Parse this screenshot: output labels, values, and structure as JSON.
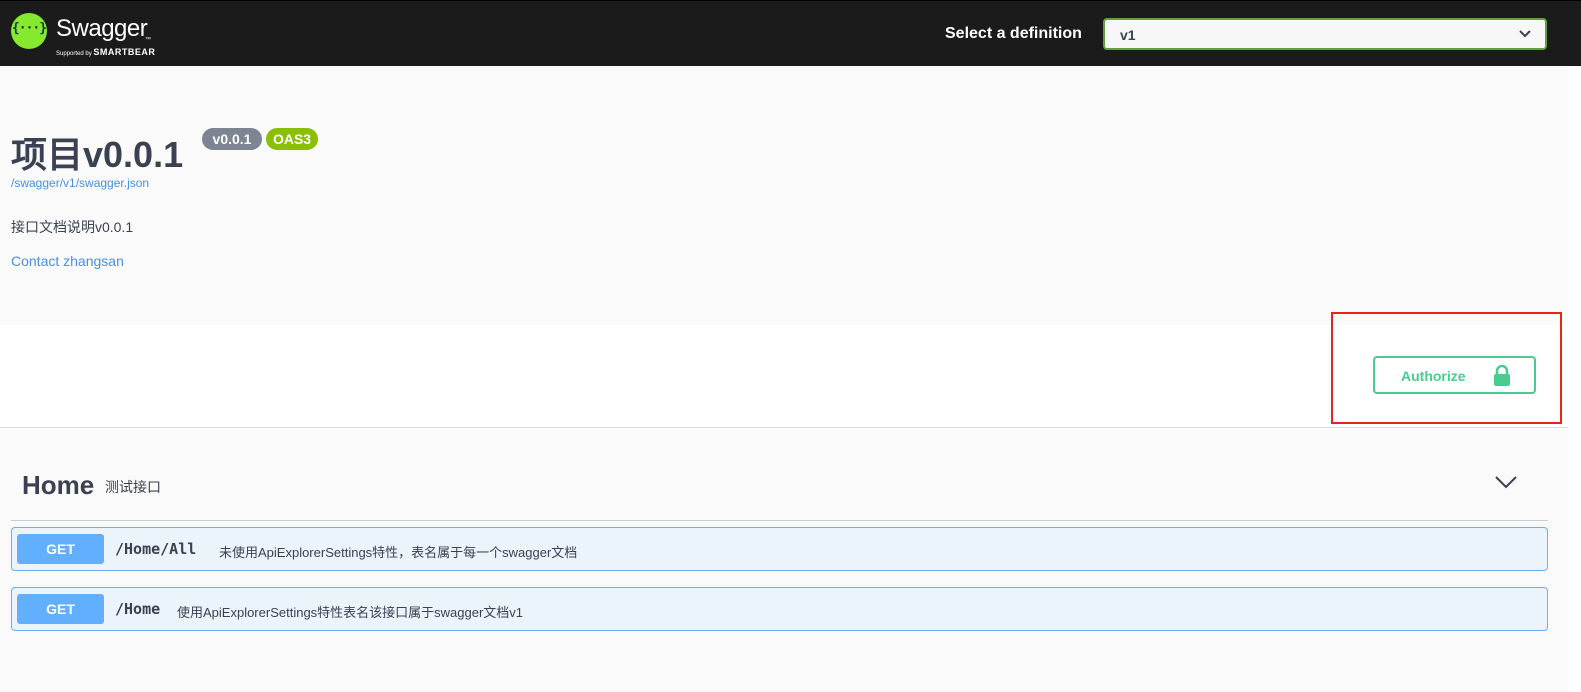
{
  "topbar": {
    "logo_title": "Swagger",
    "logo_tm": "™",
    "logo_supported": "Supported by",
    "logo_brand": "SMARTBEAR",
    "definition_label": "Select a definition",
    "definition_value": "v1"
  },
  "info": {
    "title": "项目v0.0.1",
    "version_badge": "v0.0.1",
    "oas_badge": "OAS3",
    "url": "/swagger/v1/swagger.json",
    "description": "接口文档说明v0.0.1",
    "contact": "Contact zhangsan"
  },
  "authorize": {
    "label": "Authorize",
    "color": "#49cc90",
    "highlight_color": "#e8231b"
  },
  "tags": [
    {
      "name": "Home",
      "description": "测试接口",
      "operations": [
        {
          "method": "GET",
          "path": "/Home/All",
          "summary": "未使用ApiExplorerSettings特性，表名属于每一个swagger文档"
        },
        {
          "method": "GET",
          "path": "/Home",
          "summary": "使用ApiExplorerSettings特性表名该接口属于swagger文档v1"
        }
      ]
    }
  ],
  "colors": {
    "topbar_bg": "#1b1b1b",
    "logo_green": "#85ea2d",
    "get_blue": "#61affe",
    "link_blue": "#4990e2"
  }
}
